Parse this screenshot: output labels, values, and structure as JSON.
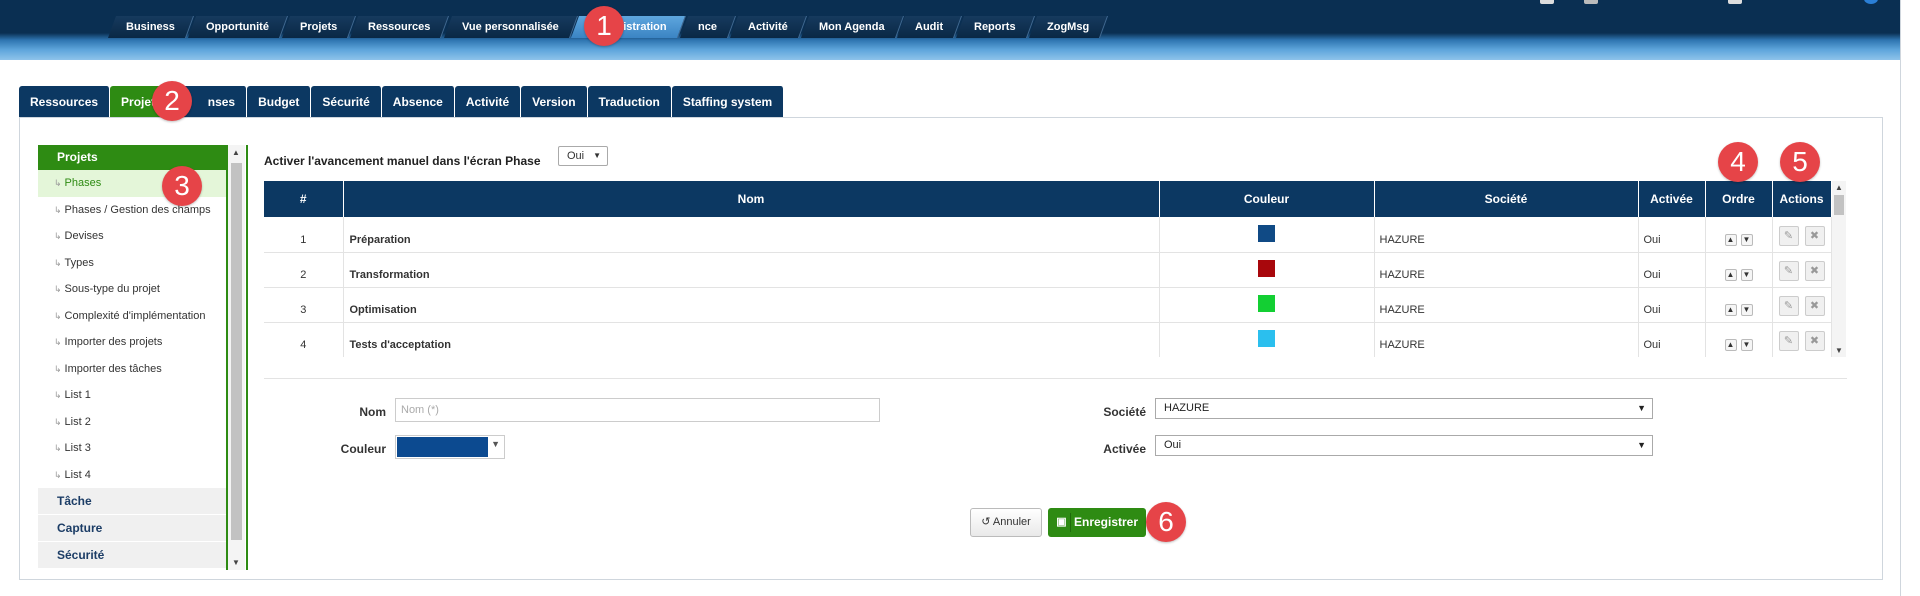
{
  "top_nav": {
    "tabs": [
      "Business",
      "Opportunité",
      "Projets",
      "Ressources",
      "Vue personnalisée",
      "Administration",
      "nce",
      "Activité",
      "Mon Agenda",
      "Audit",
      "Reports",
      "ZogMsg"
    ],
    "active": "Administration"
  },
  "sub_tabs": {
    "tabs": [
      "Ressources",
      "Projets",
      "nses",
      "Budget",
      "Sécurité",
      "Absence",
      "Activité",
      "Version",
      "Traduction",
      "Staffing system"
    ],
    "active": "Projets"
  },
  "sidebar": {
    "header": "Projets",
    "items": [
      "Phases",
      "Phases / Gestion des champs",
      "Devises",
      "Types",
      "Sous-type du projet",
      "Complexité d'implémentation",
      "Importer des projets",
      "Importer des tâches",
      "List 1",
      "List 2",
      "List 3",
      "List 4"
    ],
    "active": "Phases",
    "groups": [
      "Tâche",
      "Capture",
      "Sécurité"
    ]
  },
  "setting": {
    "label": "Activer l'avancement manuel dans l'écran Phase",
    "value": "Oui"
  },
  "table": {
    "headers": [
      "#",
      "Nom",
      "Couleur",
      "Société",
      "Activée",
      "Ordre",
      "Actions"
    ],
    "rows": [
      {
        "num": "1",
        "name": "Préparation",
        "color": "#104a85",
        "company": "HAZURE",
        "active": "Oui"
      },
      {
        "num": "2",
        "name": "Transformation",
        "color": "#a8070c",
        "company": "HAZURE",
        "active": "Oui"
      },
      {
        "num": "3",
        "name": "Optimisation",
        "color": "#13cf33",
        "company": "HAZURE",
        "active": "Oui"
      },
      {
        "num": "4",
        "name": "Tests d'acceptation",
        "color": "#2bbfee",
        "company": "HAZURE",
        "active": "Oui"
      }
    ]
  },
  "form": {
    "nom_label": "Nom",
    "nom_placeholder": "Nom (*)",
    "couleur_label": "Couleur",
    "couleur_value": "#0c4a90",
    "societe_label": "Société",
    "societe_value": "HAZURE",
    "activee_label": "Activée",
    "activee_value": "Oui"
  },
  "buttons": {
    "cancel": "Annuler",
    "save": "Enregistrer"
  },
  "callouts": [
    "1",
    "2",
    "3",
    "4",
    "5",
    "6"
  ],
  "icons": [
    "up-arrow-icon",
    "down-arrow-icon",
    "edit-icon",
    "delete-icon",
    "undo-icon",
    "save-icon"
  ],
  "colors": {
    "navy": "#0c3862",
    "green": "#2e8b13",
    "callout": "#e64448"
  }
}
